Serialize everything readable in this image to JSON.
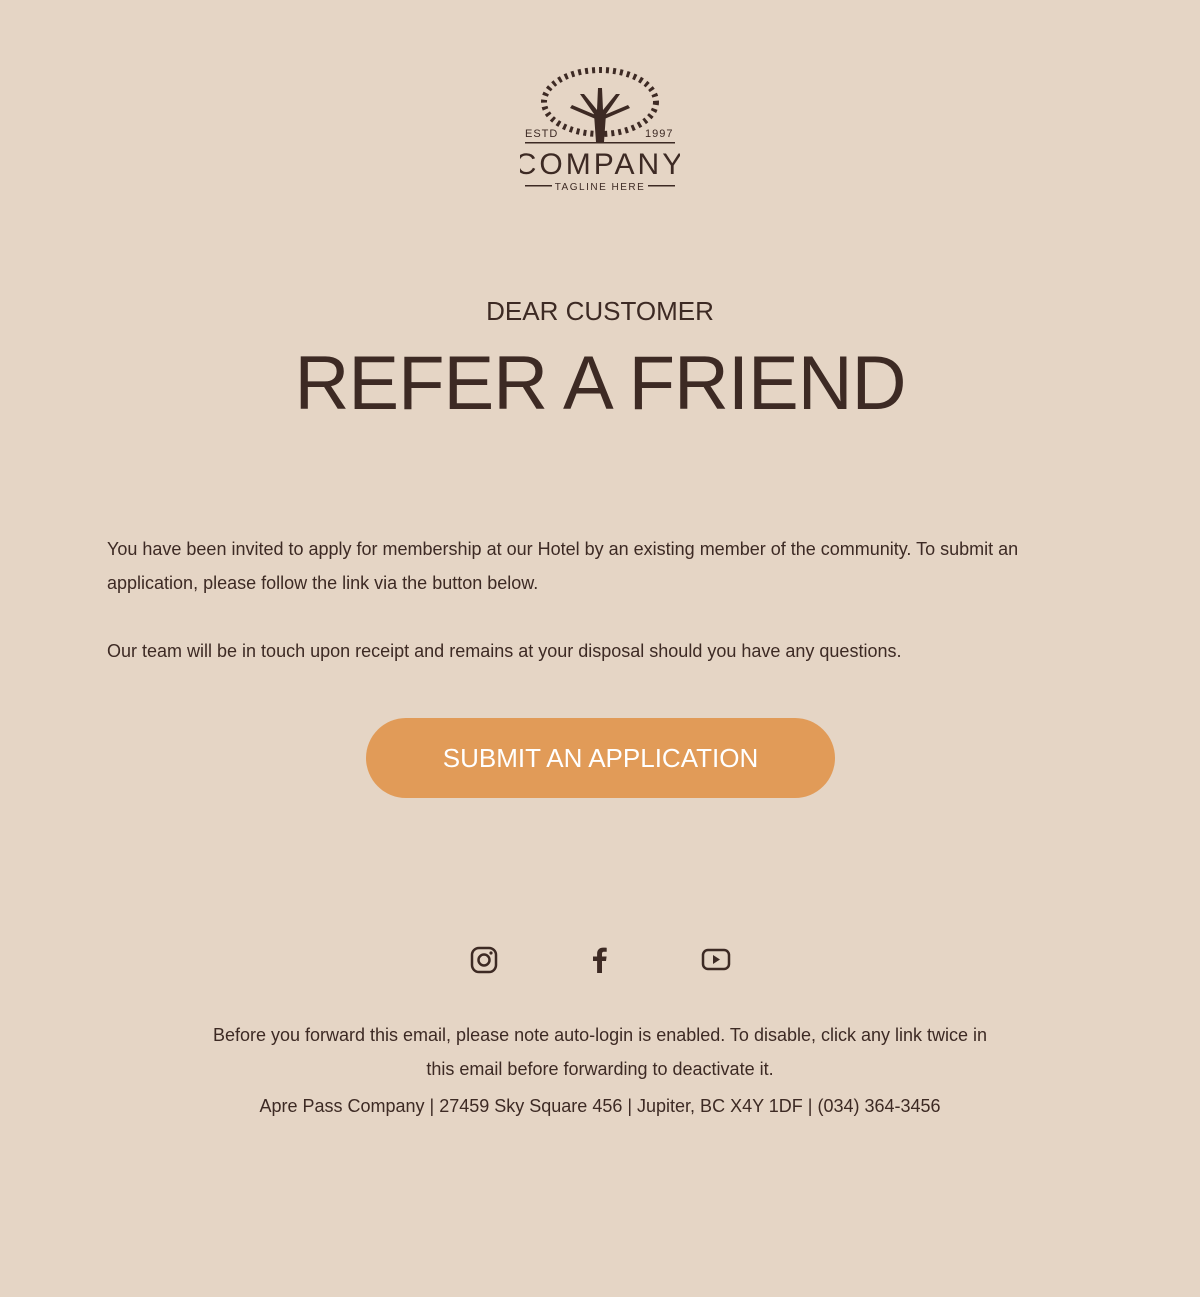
{
  "logo": {
    "estd": "ESTD",
    "year": "1997",
    "name": "COMPANY",
    "tagline": "TAGLINE HERE"
  },
  "header": {
    "greeting": "DEAR CUSTOMER",
    "title": "REFER A FRIEND"
  },
  "body": {
    "p1": "You have been invited to apply for membership at our Hotel by an existing member of the community. To submit an application, please follow the link via the button below.",
    "p2": "Our team will be in touch upon receipt and remains at your disposal should you have any questions."
  },
  "cta": {
    "label": "SUBMIT AN APPLICATION",
    "color": "#e19b58"
  },
  "social": [
    "instagram-icon",
    "facebook-icon",
    "youtube-icon"
  ],
  "footer": {
    "note": "Before you forward this email, please note auto-login is enabled. To disable, click any link twice in this email before forwarding to deactivate it.",
    "address": "Apre Pass Company | 27459 Sky Square 456 | Jupiter, BC X4Y 1DF | (034) 364-3456"
  }
}
